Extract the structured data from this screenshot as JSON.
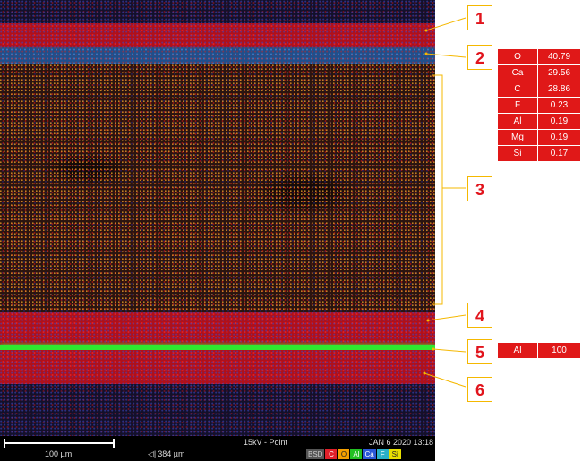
{
  "annotations": {
    "labels": [
      "1",
      "2",
      "3",
      "4",
      "5",
      "6"
    ]
  },
  "composition_point2": [
    {
      "element": "O",
      "value": "40.79"
    },
    {
      "element": "Ca",
      "value": "29.56"
    },
    {
      "element": "C",
      "value": "28.86"
    },
    {
      "element": "F",
      "value": "0.23"
    },
    {
      "element": "Al",
      "value": "0.19"
    },
    {
      "element": "Mg",
      "value": "0.19"
    },
    {
      "element": "Si",
      "value": "0.17"
    }
  ],
  "composition_point5": [
    {
      "element": "Al",
      "value": "100"
    }
  ],
  "status_bar": {
    "scale_label": "100 µm",
    "field_of_view": "384 µm",
    "beam": "15kV - Point",
    "datetime": "JAN 6 2020 13:18",
    "channels": [
      {
        "label": "BSD",
        "color": "#555555",
        "text_color": "#cccccc"
      },
      {
        "label": "C",
        "color": "#e0202a",
        "text_color": "#ffffff"
      },
      {
        "label": "O",
        "color": "#f5a000",
        "text_color": "#222222"
      },
      {
        "label": "Al",
        "color": "#22c022",
        "text_color": "#ffffff"
      },
      {
        "label": "Ca",
        "color": "#2a58d8",
        "text_color": "#ffffff"
      },
      {
        "label": "F",
        "color": "#2ab0c8",
        "text_color": "#ffffff"
      },
      {
        "label": "Si",
        "color": "#e8e000",
        "text_color": "#222222"
      }
    ]
  },
  "colors": {
    "callout_text": "#e1141c",
    "callout_border": "#f5b800",
    "table_fill": "#e01818"
  }
}
